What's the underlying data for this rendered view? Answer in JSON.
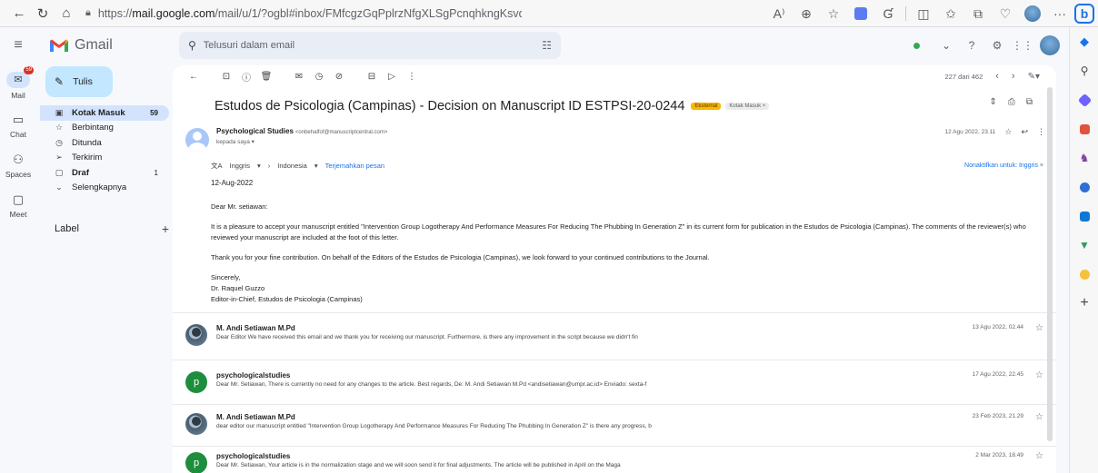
{
  "browser": {
    "url_prefix": "https://",
    "url_host": "mail.google.com",
    "url_path": "/mail/u/1/?ogbl#inbox/FMfcgzGqPplrzNfgXLSgPcnqhkngKsvd"
  },
  "gmail": {
    "logo_text": "Gmail",
    "search_placeholder": "Telusuri dalam email",
    "compose_label": "Tulis"
  },
  "rail": [
    {
      "label": "Mail",
      "icon": "mail-icon",
      "badge": "59"
    },
    {
      "label": "Chat",
      "icon": "chat-icon"
    },
    {
      "label": "Spaces",
      "icon": "spaces-icon"
    },
    {
      "label": "Meet",
      "icon": "meet-icon"
    }
  ],
  "nav": [
    {
      "label": "Kotak Masuk",
      "count": "59",
      "icon": "inbox-icon",
      "glyph": "▣"
    },
    {
      "label": "Berbintang",
      "count": "",
      "icon": "star-icon",
      "glyph": "☆"
    },
    {
      "label": "Ditunda",
      "count": "",
      "icon": "clock-icon",
      "glyph": "◷"
    },
    {
      "label": "Terkirim",
      "count": "",
      "icon": "send-icon",
      "glyph": "➢"
    },
    {
      "label": "Draf",
      "count": "1",
      "icon": "draft-icon",
      "glyph": "▢"
    },
    {
      "label": "Selengkapnya",
      "count": "",
      "icon": "chevron-down-icon",
      "glyph": "⌄"
    }
  ],
  "label_header": "Label",
  "toolbar": {
    "pagination": "227 dari 462"
  },
  "email": {
    "subject": "Estudos de Psicologia (Campinas) - Decision on Manuscript ID ESTPSI-20-0244",
    "tag_external": "Eksternal",
    "tag_inbox": "Kotak Masuk ×",
    "sender_name": "Psychological Studies",
    "sender_email": "<onbehalfof@manuscriptcentral.com>",
    "to_line": "kepada saya ▾",
    "date": "12 Agu 2022, 23.11",
    "translate": {
      "from_lang": "Inggris",
      "to_lang": "Indonesia",
      "translate_link": "Terjemahkan pesan",
      "disable_link": "Nonaktifkan untuk: Inggris ×"
    },
    "body": {
      "date_line": "12-Aug-2022",
      "greeting": "Dear Mr. setiawan:",
      "para1": "It is a pleasure to accept your manuscript entitled \"Intervention Group Logotherapy And Performance Measures For Reducing The Phubbing In Generation Z\" in its current form for publication in the Estudos de Psicologia (Campinas).  The comments of the reviewer(s) who reviewed your manuscript are included at the foot of this letter.",
      "para2": "Thank you for your fine contribution.  On behalf of the Editors of the Estudos de Psicologia (Campinas), we look forward to your continued contributions to the Journal.",
      "sign1": "Sincerely,",
      "sign2": "Dr. Raquel Guzzo",
      "sign3": "Editor-in-Chief, Estudos de Psicologia (Campinas)"
    }
  },
  "thread": [
    {
      "name": "M. Andi Setiawan M.Pd",
      "avatar": "photo",
      "letter": "",
      "date": "13 Agu 2022, 02.44",
      "snippet": "Dear Editor We have received this email and we thank you for receiving our manuscript. Furthermore, is there any improvement in the script because we didn't fin"
    },
    {
      "name": "psychologicalstudies",
      "avatar": "letter",
      "letter": "p",
      "date": "17 Agu 2022, 22.45",
      "snippet": "Dear Mr. Setiawan, There is currently no need for any changes to the article. Best regards, De: M. Andi Setiawan M.Pd <andisetiawan@umpr.ac.id> Enviado: sexta-f"
    },
    {
      "name": "M. Andi Setiawan M.Pd",
      "avatar": "photo",
      "letter": "",
      "date": "23 Feb 2023, 21.29",
      "snippet": "dear editor our manuscript entitled \"Intervention Group Logotherapy And Performance Measures For Reducing The Phubbing In Generation Z\" is there any progress, b"
    },
    {
      "name": "psychologicalstudies",
      "avatar": "letter",
      "letter": "p",
      "date": "2 Mar 2023, 18.49",
      "snippet": "Dear Mr. Setiawan, Your article is in the normalization stage and we will soon send it for final adjustments. The article will be published in April on the Maga"
    }
  ],
  "colors": {
    "accent_blue": "#1a73e8",
    "compose_bg": "#c2e7ff",
    "active_nav_bg": "#d3e3fd",
    "external_tag": "#f9b801"
  }
}
